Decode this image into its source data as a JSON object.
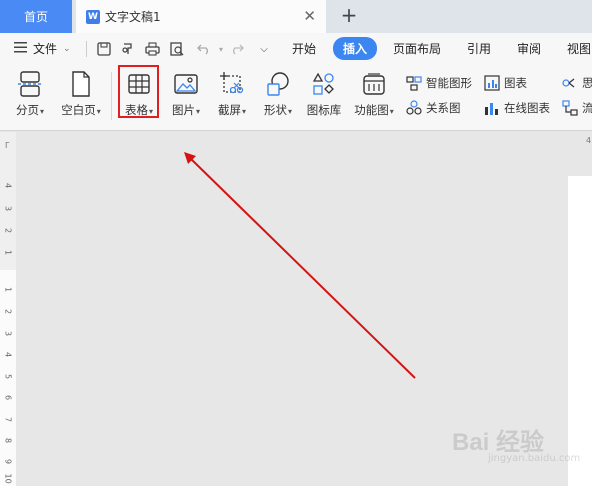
{
  "tabs": {
    "home": "首页",
    "doc_icon": "W",
    "doc_title": "文字文稿1",
    "close": "✕",
    "add": "+"
  },
  "menu": {
    "file": "文件",
    "tabs": [
      "开始",
      "插入",
      "页面布局",
      "引用",
      "审阅",
      "视图"
    ],
    "active_tab": "插入"
  },
  "ribbon": {
    "page_break": "分页",
    "blank_page": "空白页",
    "table": "表格",
    "picture": "图片",
    "screenshot": "截屏",
    "shapes": "形状",
    "icon_library": "图标库",
    "functions": "功能图",
    "smart_art": "智能图形",
    "chart": "图表",
    "relation": "关系图",
    "online_chart": "在线图表",
    "clip1": "思",
    "clip2": "流"
  },
  "ruler": {
    "corner": "Γ",
    "numbers_upper": [
      "4",
      "3",
      "2",
      "1"
    ],
    "numbers_lower": [
      "1",
      "2",
      "3",
      "4",
      "5",
      "6",
      "7",
      "8",
      "9",
      "10"
    ],
    "top_tick": "4"
  },
  "watermark": {
    "text": "Bai 经验",
    "sub": "jingyan.baidu.com"
  },
  "colors": {
    "accent": "#3b86f0",
    "highlight": "#e02020",
    "arrow": "#d41414"
  }
}
